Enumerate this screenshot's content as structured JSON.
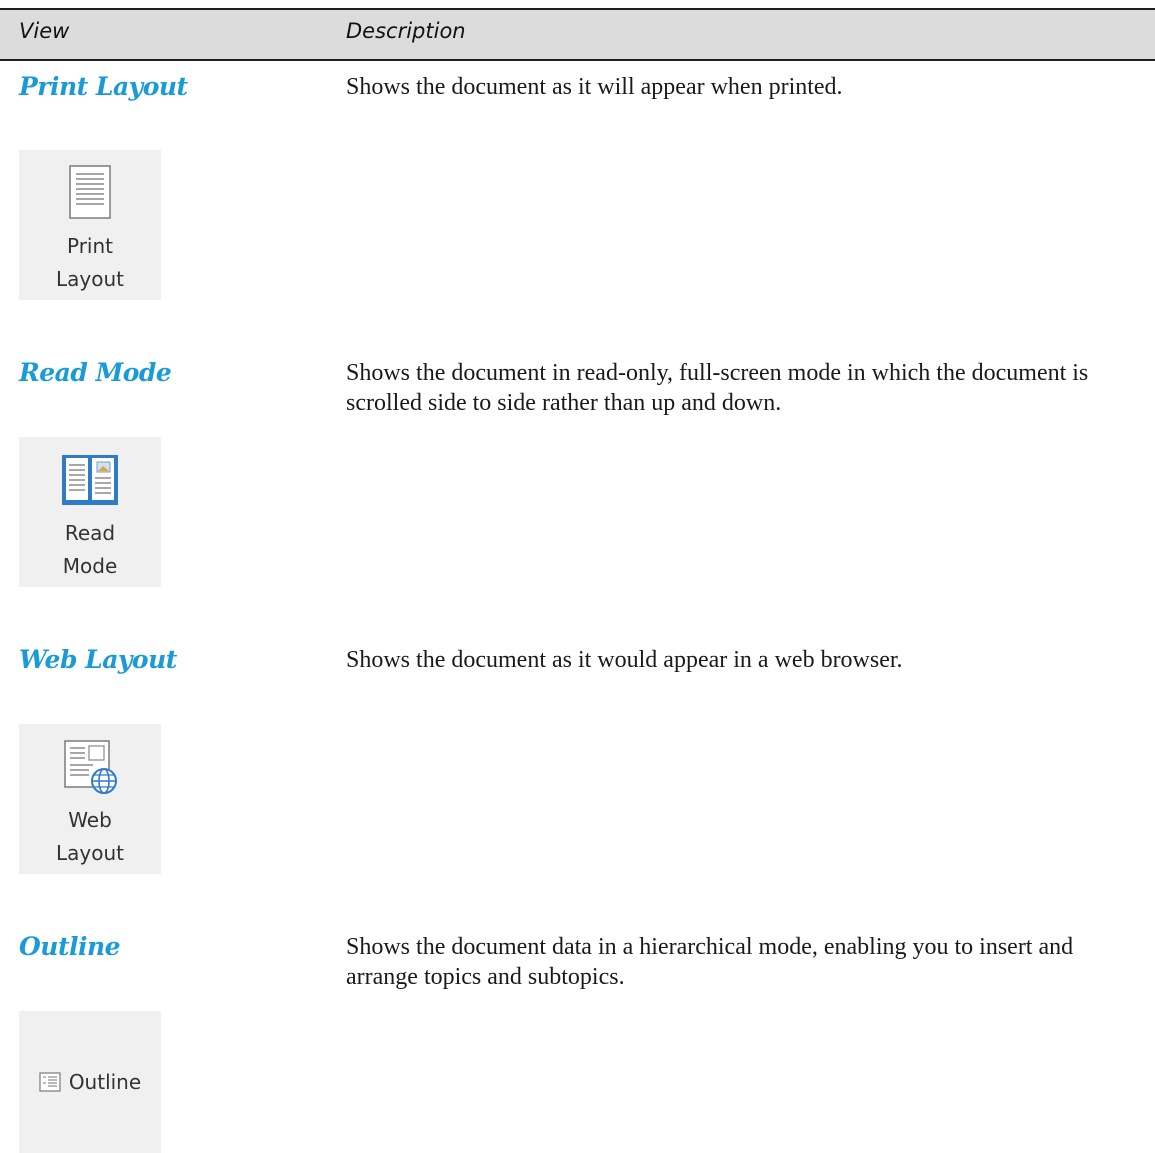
{
  "table": {
    "headers": {
      "view": "View",
      "description": "Description"
    },
    "rows": [
      {
        "view": "Print Layout",
        "description": "Shows the document as it will appear when printed.",
        "button": {
          "icon": "print-layout-icon",
          "line1": "Print",
          "line2": "Layout"
        }
      },
      {
        "view": "Read Mode",
        "description": "Shows the document in read-only, full-screen mode in which the document is scrolled side to side rather than up and down.",
        "button": {
          "icon": "read-mode-icon",
          "line1": "Read",
          "line2": "Mode"
        }
      },
      {
        "view": "Web Layout",
        "description": "Shows the document as it would appear in a web browser.",
        "button": {
          "icon": "web-layout-icon",
          "line1": "Web",
          "line2": "Layout"
        }
      },
      {
        "view": "Outline",
        "description": "Shows the document data in a hierarchical mode, enabling you to insert and arrange topics and subtopics.",
        "button": {
          "icon": "outline-icon",
          "label": "Outline"
        }
      }
    ]
  },
  "colors": {
    "view_name": "#1a9bd7",
    "header_bg": "#dcdcdc",
    "button_bg": "#f0f0f0"
  }
}
